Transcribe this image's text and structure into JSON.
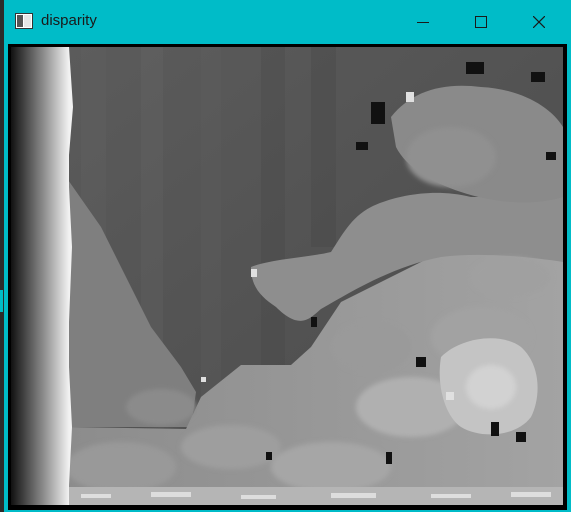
{
  "window": {
    "title": "disparity",
    "accent_color": "#00bcc8",
    "controls": [
      "minimize-icon",
      "maximize-icon",
      "close-icon"
    ]
  },
  "image": {
    "content": "disparity map"
  }
}
